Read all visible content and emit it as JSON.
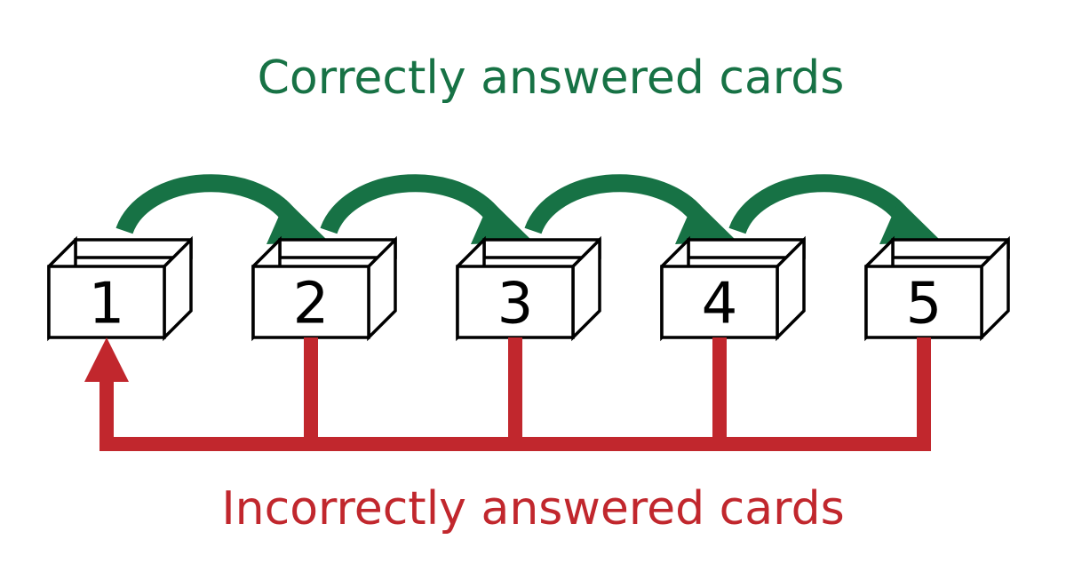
{
  "labels": {
    "correct": "Correctly answered cards",
    "incorrect": "Incorrectly answered cards"
  },
  "boxes": [
    "1",
    "2",
    "3",
    "4",
    "5"
  ],
  "colors": {
    "correct": "#177245",
    "incorrect": "#C1272D",
    "box_stroke": "#000000",
    "box_fill": "#FFFFFF"
  },
  "flow": {
    "correct_direction": "forward-one-box",
    "incorrect_direction": "back-to-first"
  }
}
